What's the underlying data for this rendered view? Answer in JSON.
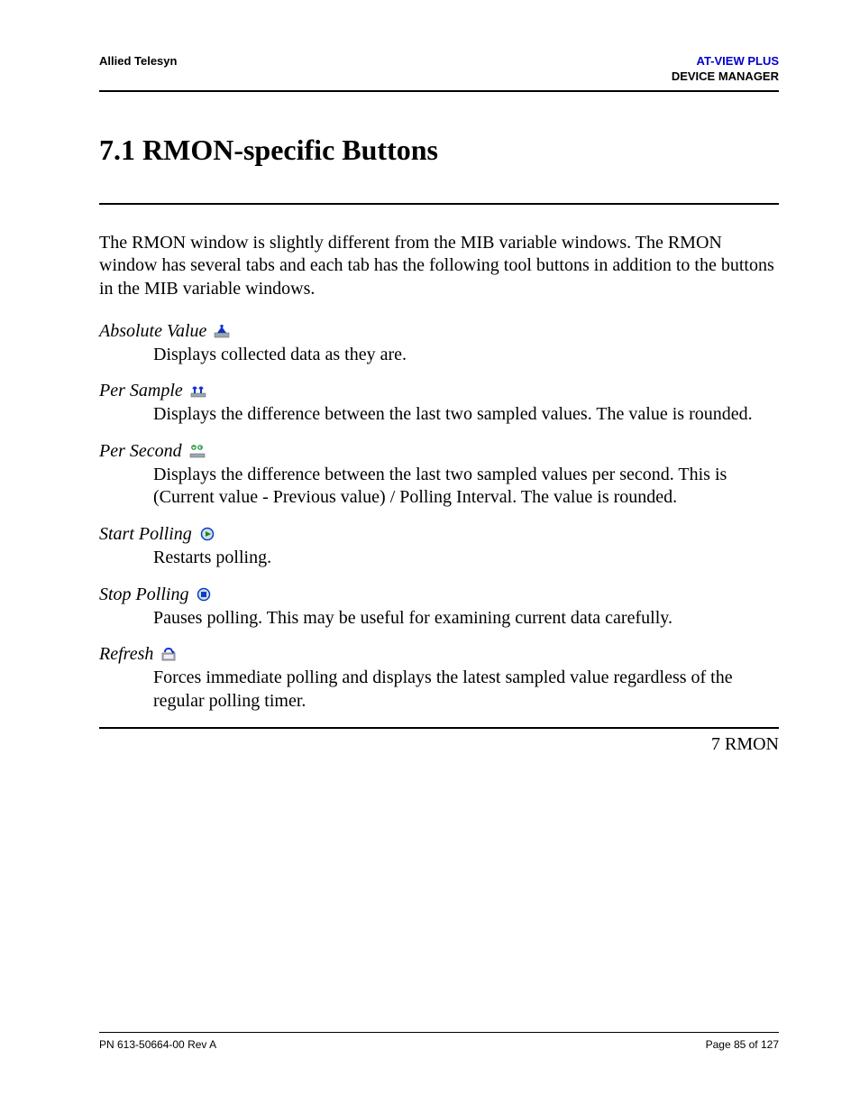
{
  "header": {
    "left": "Allied Telesyn",
    "right_line1": "AT-VIEW PLUS",
    "right_line2": "DEVICE MANAGER"
  },
  "section": {
    "title": "7.1 RMON-specific Buttons"
  },
  "intro": "The RMON window is slightly different from the MIB variable windows. The RMON window has several tabs and each tab has the following tool buttons in addition to the buttons in the MIB variable windows.",
  "items": [
    {
      "term": "Absolute Value",
      "icon": "absolute-value-icon",
      "desc": "Displays collected data as they are."
    },
    {
      "term": "Per Sample",
      "icon": "per-sample-icon",
      "desc": "Displays the difference between the last two sampled values. The value is rounded."
    },
    {
      "term": "Per Second",
      "icon": "per-second-icon",
      "desc": "Displays the difference between the last two sampled values per second. This is (Current value - Previous value) / Polling Interval. The value is rounded."
    },
    {
      "term": "Start Polling",
      "icon": "start-polling-icon",
      "desc": "Restarts polling."
    },
    {
      "term": "Stop Polling",
      "icon": "stop-polling-icon",
      "desc": "Pauses polling. This may be useful for examining current data carefully."
    },
    {
      "term": "Refresh",
      "icon": "refresh-icon",
      "desc": "Forces immediate polling and displays the latest sampled value regardless of the regular polling timer."
    }
  ],
  "chapter_ref": "7 RMON",
  "footer": {
    "left": "PN 613-50664-00 Rev A",
    "right": "Page 85 of 127"
  }
}
